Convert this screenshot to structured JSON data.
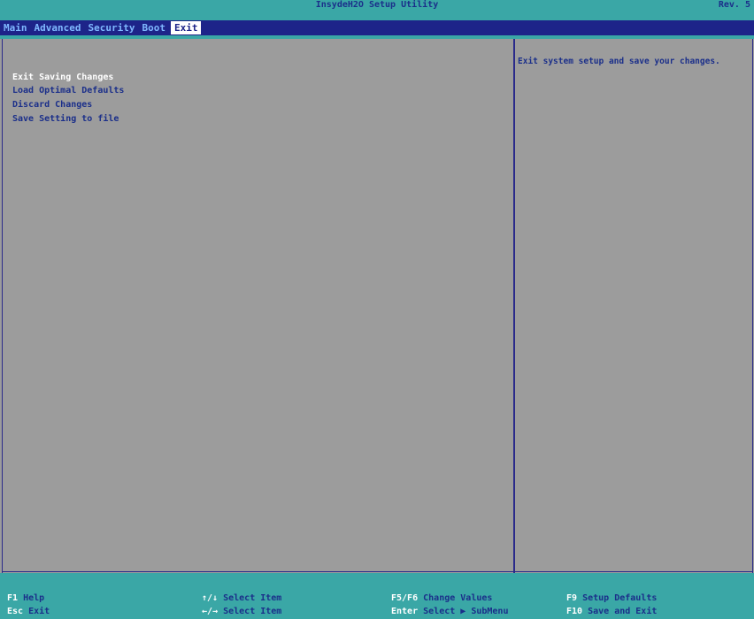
{
  "title_bar": {
    "title": "InsydeH2O Setup Utility",
    "revision": "Rev. 5"
  },
  "menu": {
    "tabs": [
      {
        "label": "Main",
        "active": false
      },
      {
        "label": "Advanced",
        "active": false
      },
      {
        "label": "Security",
        "active": false
      },
      {
        "label": "Boot",
        "active": false
      },
      {
        "label": "Exit",
        "active": true
      }
    ]
  },
  "left_panel": {
    "items": [
      {
        "label": "Exit Saving Changes",
        "selected": true
      },
      {
        "label": "Load Optimal Defaults",
        "selected": false
      },
      {
        "label": "Discard Changes",
        "selected": false
      },
      {
        "label": "Save Setting to file",
        "selected": false
      }
    ]
  },
  "right_panel": {
    "help_text": "Exit system setup and save your changes."
  },
  "footer": {
    "items": [
      {
        "key": "F1",
        "desc": "Help"
      },
      {
        "key": "Esc",
        "desc": "Exit"
      },
      {
        "key": "↑/↓",
        "desc": "Select Item"
      },
      {
        "key": "←/→",
        "desc": "Select Item"
      },
      {
        "key": "F5/F6",
        "desc": "Change Values"
      },
      {
        "key": "Enter",
        "desc": "Select ▶ SubMenu"
      },
      {
        "key": "F9",
        "desc": "Setup Defaults"
      },
      {
        "key": "F10",
        "desc": "Save and Exit"
      }
    ]
  },
  "colors": {
    "teal_bar": "#3aa7a6",
    "navy": "#1d2489",
    "panel_gray": "#9c9c9c",
    "text_blue": "#1b2f8a",
    "highlight_white": "#ffffff"
  }
}
